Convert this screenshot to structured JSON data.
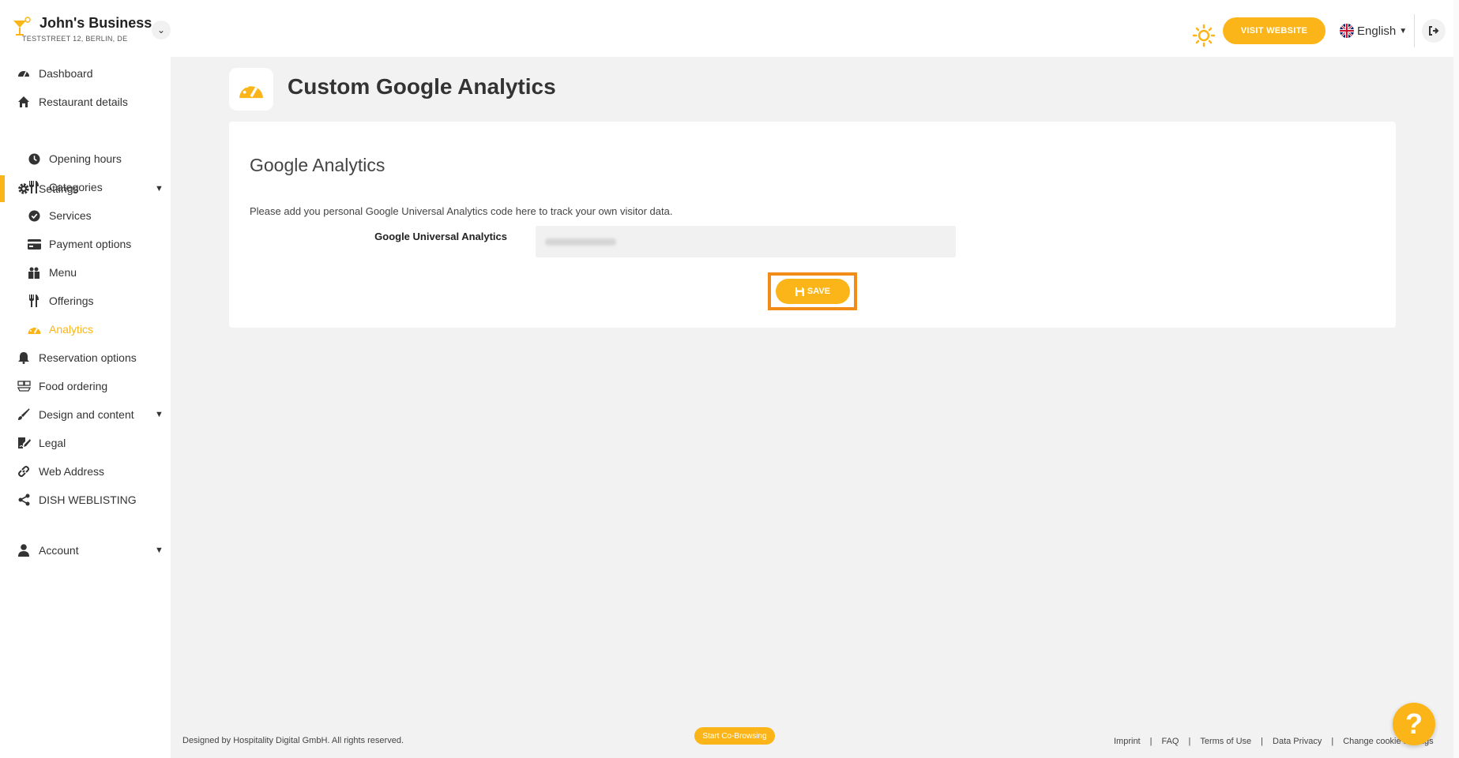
{
  "header": {
    "business_name": "John's Business",
    "address": "TESTSTREET 12, BERLIN, DE",
    "visit_website": "VISIT WEBSITE",
    "language": "English"
  },
  "sidebar": {
    "items": [
      {
        "label": "Dashboard",
        "icon": "dashboard-icon"
      },
      {
        "label": "Restaurant details",
        "icon": "home-icon"
      },
      {
        "label": "Settings",
        "icon": "gear-icon"
      },
      {
        "label": "Opening hours",
        "icon": "clock-icon"
      },
      {
        "label": "Categories",
        "icon": "utensils-icon"
      },
      {
        "label": "Services",
        "icon": "check-circle-icon"
      },
      {
        "label": "Payment options",
        "icon": "credit-card-icon"
      },
      {
        "label": "Menu",
        "icon": "menu-book-icon"
      },
      {
        "label": "Offerings",
        "icon": "utensils-icon"
      },
      {
        "label": "Analytics",
        "icon": "gauge-icon"
      },
      {
        "label": "Reservation options",
        "icon": "bell-icon"
      },
      {
        "label": "Food ordering",
        "icon": "food-ordering-icon"
      },
      {
        "label": "Design and content",
        "icon": "brush-icon"
      },
      {
        "label": "Legal",
        "icon": "signature-icon"
      },
      {
        "label": "Web Address",
        "icon": "link-icon"
      },
      {
        "label": "DISH WEBLISTING",
        "icon": "share-icon"
      },
      {
        "label": "Account",
        "icon": "user-icon"
      }
    ]
  },
  "main": {
    "page_title": "Custom Google Analytics",
    "card_title": "Google Analytics",
    "description": "Please add you personal Google Universal Analytics code here to track your own visitor data.",
    "field_label": "Google Universal Analytics",
    "save_label": "SAVE"
  },
  "footer": {
    "copyright": "Designed by Hospitality Digital GmbH. All rights reserved.",
    "cobrowse": "Start Co-Browsing",
    "links": [
      "Imprint",
      "FAQ",
      "Terms of Use",
      "Data Privacy",
      "Change cookie settings"
    ],
    "help": "?"
  },
  "colors": {
    "accent": "#fbb518",
    "highlight": "#f28c18",
    "background": "#f2f2f2"
  }
}
